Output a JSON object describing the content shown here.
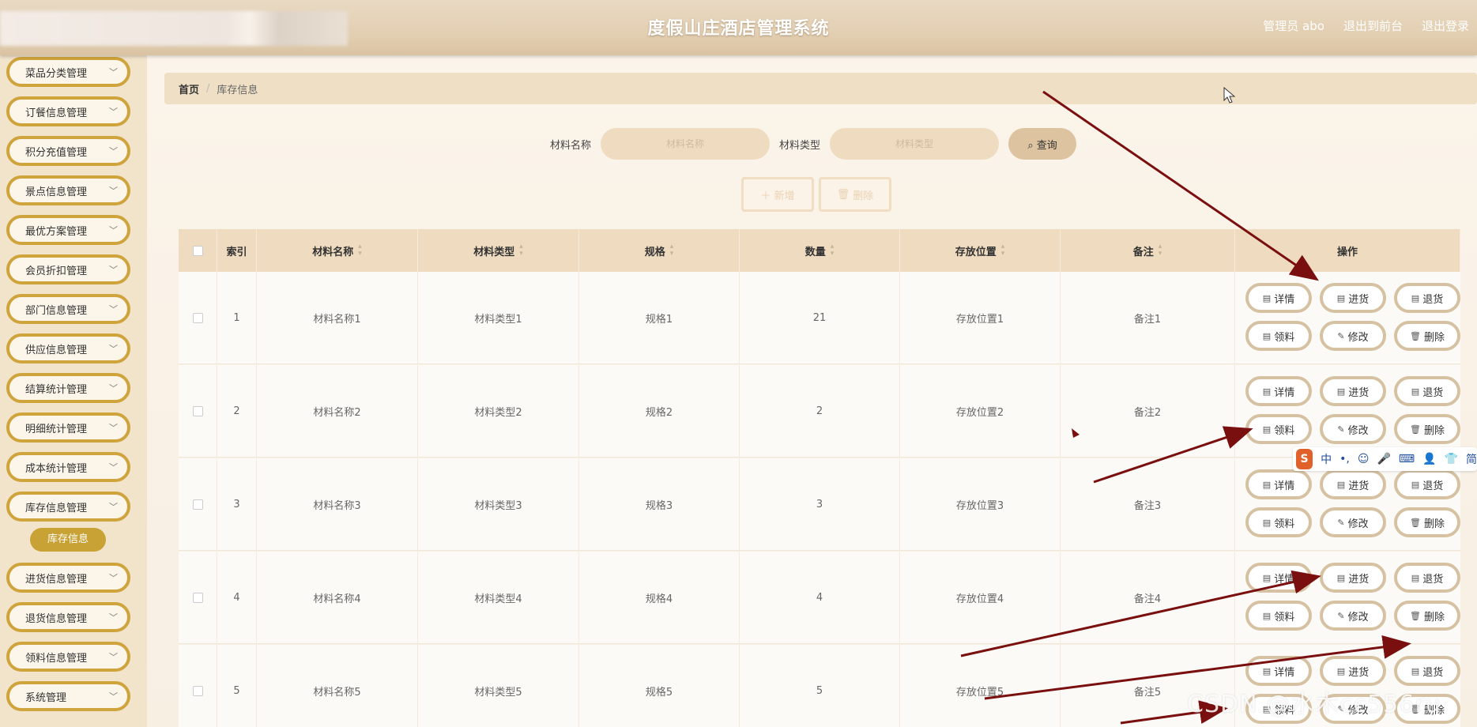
{
  "header": {
    "title": "度假山庄酒店管理系统",
    "links": [
      "管理员 abo",
      "退出到前台",
      "退出登录"
    ]
  },
  "sidebar": {
    "items": [
      {
        "label": "菜品分类管理"
      },
      {
        "label": "订餐信息管理"
      },
      {
        "label": "积分充值管理"
      },
      {
        "label": "景点信息管理"
      },
      {
        "label": "最优方案管理"
      },
      {
        "label": "会员折扣管理"
      },
      {
        "label": "部门信息管理"
      },
      {
        "label": "供应信息管理"
      },
      {
        "label": "结算统计管理"
      },
      {
        "label": "明细统计管理"
      },
      {
        "label": "成本统计管理"
      },
      {
        "label": "库存信息管理"
      },
      {
        "label": "进货信息管理"
      },
      {
        "label": "退货信息管理"
      },
      {
        "label": "领料信息管理"
      },
      {
        "label": "系统管理"
      }
    ],
    "active_sub": "库存信息"
  },
  "breadcrumb": {
    "home": "首页",
    "separator": "/",
    "current": "库存信息"
  },
  "search": {
    "name_label": "材料名称",
    "name_placeholder": "材料名称",
    "type_label": "材料类型",
    "type_placeholder": "材料类型",
    "button": "查询"
  },
  "actions": {
    "add": "新增",
    "delete": "删除"
  },
  "table": {
    "columns": [
      "索引",
      "材料名称",
      "材料类型",
      "规格",
      "数量",
      "存放位置",
      "备注",
      "操作"
    ],
    "rows": [
      {
        "index": "1",
        "name": "材料名称1",
        "type": "材料类型1",
        "spec": "规格1",
        "qty": "21",
        "location": "存放位置1",
        "note": "备注1"
      },
      {
        "index": "2",
        "name": "材料名称2",
        "type": "材料类型2",
        "spec": "规格2",
        "qty": "2",
        "location": "存放位置2",
        "note": "备注2"
      },
      {
        "index": "3",
        "name": "材料名称3",
        "type": "材料类型3",
        "spec": "规格3",
        "qty": "3",
        "location": "存放位置3",
        "note": "备注3"
      },
      {
        "index": "4",
        "name": "材料名称4",
        "type": "材料类型4",
        "spec": "规格4",
        "qty": "4",
        "location": "存放位置4",
        "note": "备注4"
      },
      {
        "index": "5",
        "name": "材料名称5",
        "type": "材料类型5",
        "spec": "规格5",
        "qty": "5",
        "location": "存放位置5",
        "note": "备注5"
      }
    ],
    "row_ops": [
      "详情",
      "进货",
      "退货",
      "领料",
      "修改",
      "删除"
    ]
  },
  "ime": {
    "logo": "S",
    "items": [
      "中",
      "•,",
      "☺",
      "🎤",
      "⌨",
      "👤",
      "👕",
      "简"
    ]
  },
  "watermark": "CSDN @水木cc556ru",
  "colors": {
    "accent": "#cfa43c",
    "arrow": "#7a0f0f",
    "header_bg": "#e3cfb2"
  }
}
